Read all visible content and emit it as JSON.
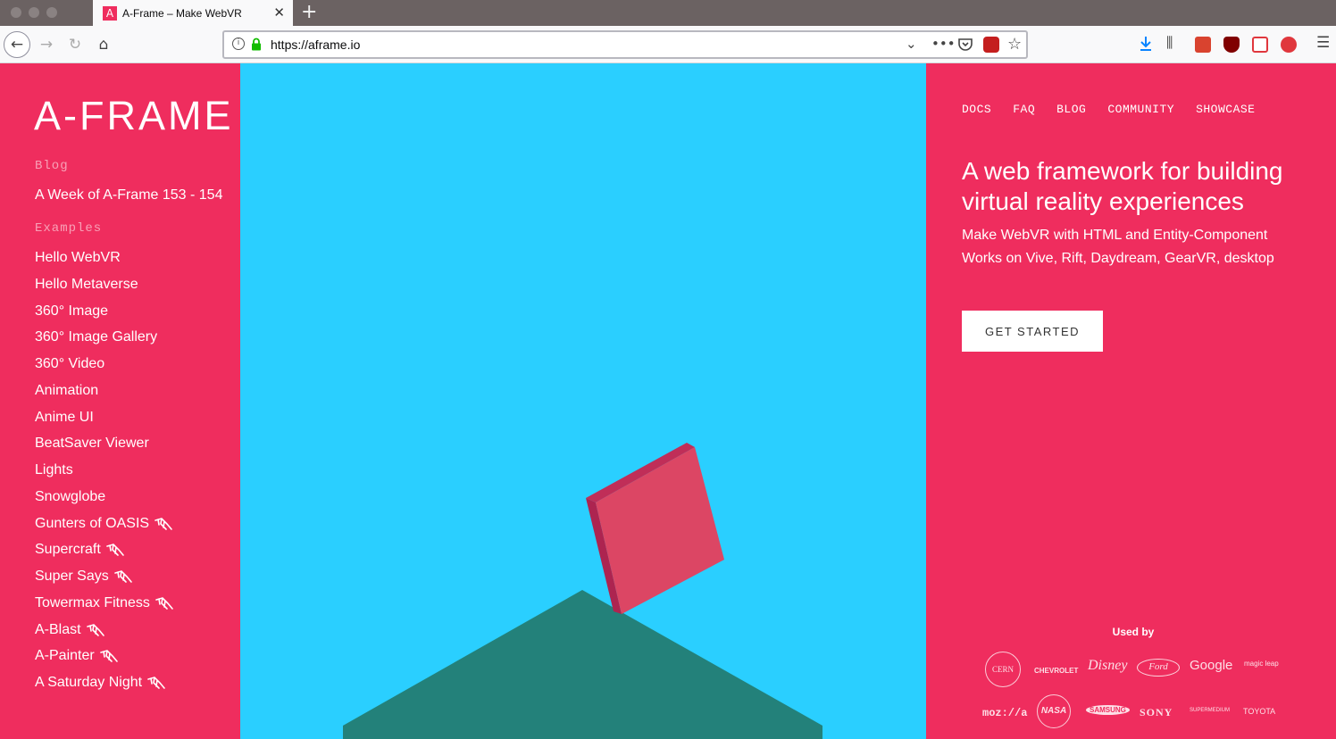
{
  "browser": {
    "tab_title": "A-Frame – Make WebVR",
    "tab_favicon": "A",
    "url": "https://aframe.io"
  },
  "sidebar": {
    "logo": "A-FRAME",
    "blog_heading": "Blog",
    "blog_link": "A Week of A-Frame 153 - 154",
    "examples_heading": "Examples",
    "examples": [
      {
        "label": "Hello WebVR",
        "wip": false
      },
      {
        "label": "Hello Metaverse",
        "wip": false
      },
      {
        "label": "360° Image",
        "wip": false
      },
      {
        "label": "360° Image Gallery",
        "wip": false
      },
      {
        "label": "360° Video",
        "wip": false
      },
      {
        "label": "Animation",
        "wip": false
      },
      {
        "label": "Anime UI",
        "wip": false
      },
      {
        "label": "BeatSaver Viewer",
        "wip": false
      },
      {
        "label": "Lights",
        "wip": false
      },
      {
        "label": "Snowglobe",
        "wip": false
      },
      {
        "label": "Gunters of OASIS",
        "wip": true
      },
      {
        "label": "Supercraft",
        "wip": true
      },
      {
        "label": "Super Says",
        "wip": true
      },
      {
        "label": "Towermax Fitness",
        "wip": true
      },
      {
        "label": "A-Blast",
        "wip": true
      },
      {
        "label": "A-Painter",
        "wip": true
      },
      {
        "label": "A Saturday Night",
        "wip": true
      }
    ]
  },
  "nav": {
    "items": [
      "DOCS",
      "FAQ",
      "BLOG",
      "COMMUNITY",
      "SHOWCASE"
    ]
  },
  "hero": {
    "headline": "A web framework for building virtual reality experiences",
    "subline": "Make WebVR with HTML and Entity-Component Works on Vive, Rift, Daydream, GearVR, desktop",
    "cta": "GET STARTED"
  },
  "used_by": {
    "heading": "Used by",
    "logos": [
      "CERN",
      "CHEVROLET",
      "Disney",
      "Ford",
      "Google",
      "magic leap",
      "moz://a",
      "NASA",
      "SAMSUNG",
      "SONY",
      "SUPERMEDIUM",
      "TOYOTA"
    ]
  },
  "colors": {
    "brand": "#ef2d5e",
    "sky": "#2acfff",
    "ground": "#23817a",
    "box": "#dc4664"
  }
}
